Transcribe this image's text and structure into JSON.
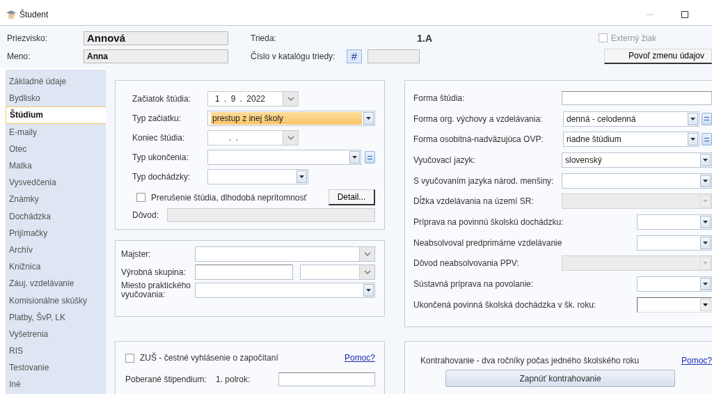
{
  "window": {
    "title": "Študent"
  },
  "header": {
    "surname_label": "Priezvisko:",
    "surname": "Annová",
    "name_label": "Meno:",
    "name": "Anna",
    "class_label": "Trieda:",
    "class": "1.A",
    "catalog_label": "Číslo v katalógu triedy:",
    "catalog_button": "#",
    "external": {
      "label": "Externý žiak",
      "checked": false,
      "disabled": true
    },
    "edit_button": "Povoľ zmenu údajov"
  },
  "sidebar": {
    "items": [
      {
        "label": "Základné údaje",
        "selected": false
      },
      {
        "label": "Bydlisko",
        "selected": false
      },
      {
        "label": "Štúdium",
        "selected": true
      },
      {
        "label": "E-maily",
        "selected": false
      },
      {
        "label": "Otec",
        "selected": false
      },
      {
        "label": "Matka",
        "selected": false
      },
      {
        "label": "Vysvedčenia",
        "selected": false
      },
      {
        "label": "Známky",
        "selected": false
      },
      {
        "label": "Dochádzka",
        "selected": false
      },
      {
        "label": "Prijímačky",
        "selected": false
      },
      {
        "label": "Archív",
        "selected": false
      },
      {
        "label": "Knižnica",
        "selected": false
      },
      {
        "label": "Záuj. vzdelávanie",
        "selected": false
      },
      {
        "label": "Komisionálne skúšky",
        "selected": false
      },
      {
        "label": "Platby, ŠvP, LK",
        "selected": false
      },
      {
        "label": "Vyšetrenia",
        "selected": false
      },
      {
        "label": "RIS",
        "selected": false
      },
      {
        "label": "Testovanie",
        "selected": false
      },
      {
        "label": "Iné",
        "selected": false
      }
    ]
  },
  "study": {
    "fields": [
      {
        "kind": "date",
        "label": "Začiatok štúdia:",
        "value": "1 .  9 .  2022",
        "edit_button": false
      },
      {
        "kind": "combo",
        "label": "Typ začiatku:",
        "value": "prestup z inej školy",
        "focused": true,
        "edit_button": false
      },
      {
        "kind": "date",
        "label": "Koniec štúdia:",
        "value": ".      .",
        "edit_button": false
      },
      {
        "kind": "combo",
        "label": "Typ ukončenia:",
        "focused": false,
        "edit_button": true
      },
      {
        "kind": "combo-short",
        "label": "Typ dochádzky:",
        "focused": false,
        "edit_button": false
      }
    ],
    "interruption": {
      "label": "Prerušenie štúdia, dlhodobá neprítomnosť",
      "checked": false
    },
    "detail_button": "Detail...",
    "reason_label": "Dôvod:",
    "reason_disabled": true
  },
  "vocational": {
    "rows": [
      {
        "kind": "chevron",
        "label": "Majster:"
      },
      {
        "kind": "text-chevron",
        "label": "Výrobná skupina:"
      },
      {
        "kind": "combo",
        "label": "Miesto praktického vyučovania:"
      }
    ]
  },
  "zus": {
    "checkbox": {
      "label": "ZUŠ - čestné vyhlásenie o započítaní",
      "checked": false
    },
    "help_link": "Pomoc?",
    "stipend_label": "Poberané štipendium:",
    "first_term_label": "1. polrok:"
  },
  "form": {
    "fields": [
      {
        "kind": "text",
        "label": "Forma štúdia:",
        "disabled": false,
        "edit_button": false
      },
      {
        "kind": "combo",
        "label": "Forma org. výchovy a vzdelávania:",
        "value": "denná - celodenná",
        "disabled": false,
        "edit_button": true
      },
      {
        "kind": "combo",
        "label": "Forma osobitná-nadväzujúca OVP:",
        "value": "riadne štúdium",
        "disabled": false,
        "edit_button": true
      },
      {
        "kind": "combo",
        "label": "Vyučovací jazyk:",
        "value": "slovenský",
        "disabled": false,
        "edit_button": false
      },
      {
        "kind": "combo",
        "label": "S vyučovaním jazyka národ. menšiny:",
        "disabled": false,
        "edit_button": false
      },
      {
        "kind": "combo",
        "label": "Dĺžka vzdelávania na území SR:",
        "disabled": true,
        "edit_button": false
      },
      {
        "kind": "combo-short",
        "label": "Príprava na povinnú školskú dochádzku:",
        "disabled": false,
        "edit_button": false
      },
      {
        "kind": "combo-short",
        "label": "Neabsolvoval predprimárne vzdelávanie",
        "disabled": false,
        "edit_button": false
      },
      {
        "kind": "combo",
        "label": "Dôvod neabsolvovania PPV:",
        "disabled": true,
        "edit_button": false
      },
      {
        "kind": "combo-short",
        "label": "Sústavná príprava na povolanie:",
        "disabled": false,
        "edit_button": false
      },
      {
        "kind": "classic-short",
        "label": "Ukončená povinná školská dochádzka v šk. roku:",
        "disabled": false,
        "edit_button": false
      }
    ]
  },
  "contract": {
    "text": "Kontrahovanie - dva ročníky počas jedného školského roku",
    "help_link": "Pomoc?",
    "button": "Zapnúť kontrahovanie"
  }
}
